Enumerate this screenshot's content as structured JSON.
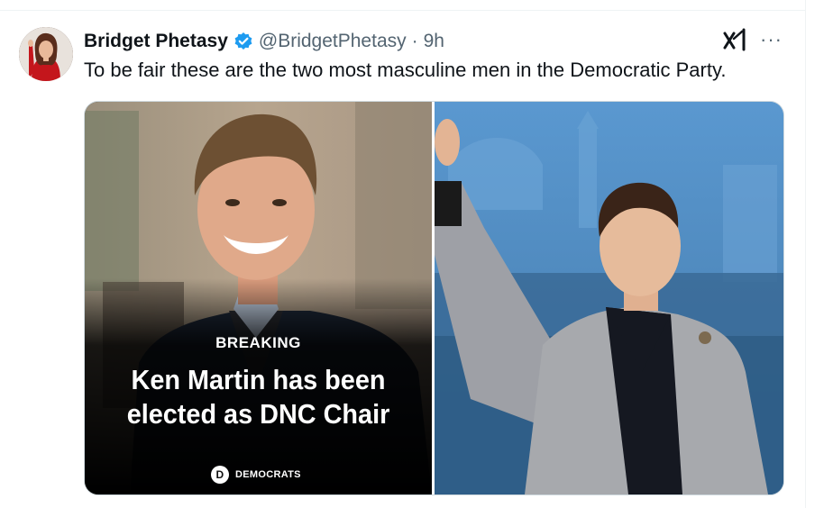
{
  "tweet": {
    "author_name": "Bridget Phetasy",
    "handle": "@BridgetPhetasy",
    "separator": "·",
    "time": "9h",
    "text": "To be fair these are the two most masculine men in the Democratic Party.",
    "more_label": "···"
  },
  "media": {
    "left_image": {
      "breaking_label": "BREAKING",
      "headline_line1": "Ken Martin has been",
      "headline_line2": "elected as DNC Chair",
      "brand_logo_letter": "D",
      "brand_label": "DEMOCRATS"
    }
  },
  "icons": {
    "verified": "verified-badge-icon",
    "grok": "grok-icon",
    "more": "more-icon"
  },
  "colors": {
    "text_primary": "#0f1419",
    "text_secondary": "#536471",
    "verified_blue": "#1d9bf0",
    "border": "#cfd9de"
  }
}
